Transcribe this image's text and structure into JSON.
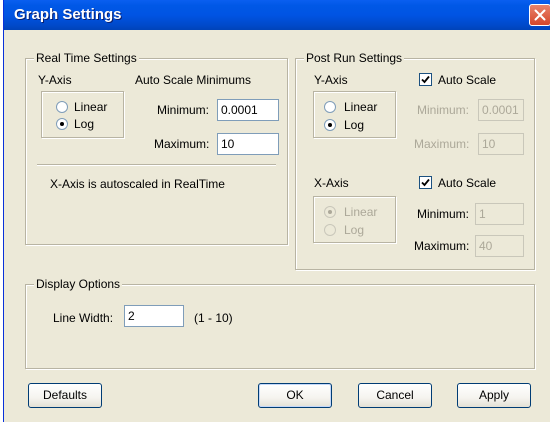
{
  "window": {
    "title": "Graph Settings",
    "close_icon": "close-icon"
  },
  "realtime": {
    "title": "Real Time Settings",
    "yaxis_label": "Y-Axis",
    "linear_label": "Linear",
    "log_label": "Log",
    "selected": "Log",
    "autoscale_title": "Auto Scale Minimums",
    "minimum_label": "Minimum:",
    "minimum_value": "0.0001",
    "maximum_label": "Maximum:",
    "maximum_value": "10",
    "xaxis_note": "X-Axis is autoscaled in RealTime"
  },
  "postrun": {
    "title": "Post Run Settings",
    "yaxis_label": "Y-Axis",
    "y_autoscale_label": "Auto Scale",
    "y_autoscale_checked": true,
    "y_linear_label": "Linear",
    "y_log_label": "Log",
    "y_selected": "Log",
    "y_minimum_label": "Minimum:",
    "y_minimum_value": "0.0001",
    "y_maximum_label": "Maximum:",
    "y_maximum_value": "10",
    "xaxis_label": "X-Axis",
    "x_autoscale_label": "Auto Scale",
    "x_autoscale_checked": true,
    "x_linear_label": "Linear",
    "x_log_label": "Log",
    "x_selected": "Linear",
    "x_minimum_label": "Minimum:",
    "x_minimum_value": "1",
    "x_maximum_label": "Maximum:",
    "x_maximum_value": "40"
  },
  "display": {
    "title": "Display Options",
    "line_width_label": "Line Width:",
    "line_width_value": "2",
    "line_width_range": "(1 - 10)"
  },
  "buttons": {
    "defaults": "Defaults",
    "ok": "OK",
    "cancel": "Cancel",
    "apply": "Apply"
  },
  "colors": {
    "titlebar": "#0054e3",
    "dialog_bg": "#ece9d8",
    "close_button": "#d5462a",
    "disabled_text": "#aca899"
  }
}
